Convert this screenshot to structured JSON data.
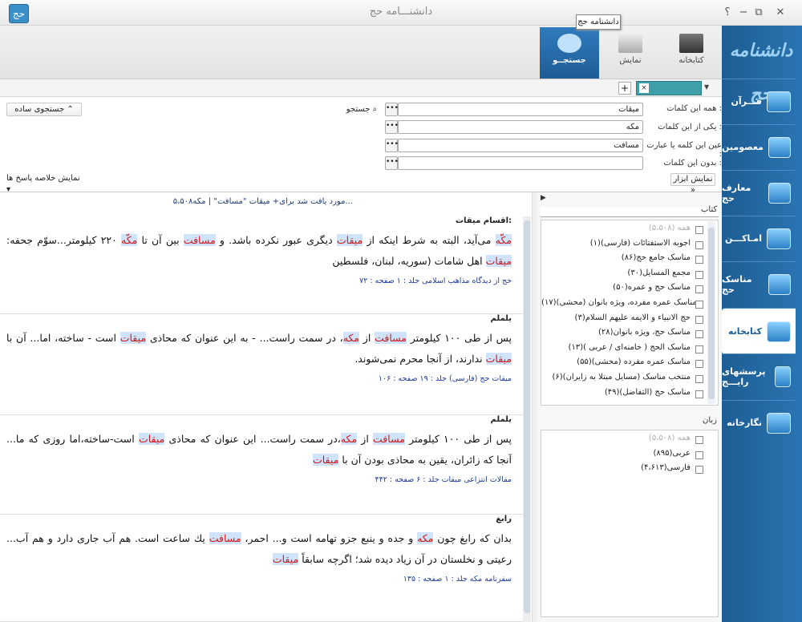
{
  "window": {
    "title": "دانشنـــامه حج",
    "help": "؟",
    "minimize": "−",
    "restore": "⧉",
    "close": "✕",
    "tooltip": "دانشنامه حج"
  },
  "sidebar": {
    "logo": "دانشنامه حج",
    "items": [
      {
        "label": "قـــرآن"
      },
      {
        "label": "معصومین"
      },
      {
        "label": "معارف حج"
      },
      {
        "label": "امـاکـــن"
      },
      {
        "label": "مناسک حج"
      },
      {
        "label": "کتابخانه"
      },
      {
        "label": "پرسشهای رایـــج"
      },
      {
        "label": "نگارخانه"
      }
    ]
  },
  "ribbon": {
    "tabs": [
      {
        "label": "کتابخانه"
      },
      {
        "label": "نمایش"
      },
      {
        "label": "جستجــو"
      }
    ]
  },
  "tabstrip": {
    "close": "×",
    "add": "+",
    "dropdown": "▼"
  },
  "form": {
    "all_words_label": "همه این کلمات :",
    "all_words_value": "میقات",
    "any_words_label": "یکی از این کلمات :",
    "any_words_value": "مکه",
    "exact_label": "عین این کلمه یا عبارت :",
    "exact_value": "مسافت",
    "without_label": "بدون این کلمات :",
    "without_value": "",
    "dots": "•••",
    "search_button": "جستجو ⌕",
    "simple_search": "جستجوی ساده  ⌃",
    "tools": "نمایش ابزار »",
    "summary": "نمایش خلاصه پاسخ ها ▾"
  },
  "results": {
    "count_text": "۵،۵۰۸مورد یافت شد برای+ میقات \"مسافت\" | مکه...",
    "items": [
      {
        "title": "اقسام میقات:",
        "parts": [
          [
            "hl",
            "مکّه"
          ],
          [
            "t",
            " می‌آید، البته به شرط اینکه از "
          ],
          [
            "hl",
            "میقات"
          ],
          [
            "t",
            " دیگری عبور نکرده باشد. و "
          ],
          [
            "hl",
            "مسافت"
          ],
          [
            "t",
            " بین آن تا "
          ],
          [
            "hl",
            "مکّه"
          ],
          [
            "t",
            " ۲۲۰ کیلومتر...سوّم جحفه: "
          ],
          [
            "hl",
            "میقات"
          ],
          [
            "t",
            " اهل شامات (سوریه، لبنان، فلسطین"
          ]
        ],
        "source": "حج از دیدگاه مذاهب اسلامی جلد : ۱ صفحه : ۷۲"
      },
      {
        "title": "یلملم",
        "parts": [
          [
            "t",
            "پس از طی ۱۰۰ کیلومتر "
          ],
          [
            "hl",
            "مسافت"
          ],
          [
            "t",
            " از "
          ],
          [
            "hl",
            "مکه"
          ],
          [
            "t",
            "، در سمت راست... - به این عنوان که محاذی "
          ],
          [
            "hl",
            "میقات"
          ],
          [
            "t",
            " است - ساخته، اما... آن با "
          ],
          [
            "hl",
            "میقات"
          ],
          [
            "t",
            " ندارند، از آنجا محرم نمی‌شوند."
          ]
        ],
        "source": "میقات حج (فارسی) جلد : ۱۹ صفحه : ۱۰۶"
      },
      {
        "title": "یلملم",
        "parts": [
          [
            "t",
            "پس از طی ۱۰۰ کیلومتر "
          ],
          [
            "hl",
            "مسافت"
          ],
          [
            "t",
            " از "
          ],
          [
            "hl",
            "مکه"
          ],
          [
            "t",
            "،در سمت راست... این عنوان که محاذی "
          ],
          [
            "hl",
            "میقات"
          ],
          [
            "t",
            " است-ساخته،اما روزی که ما... آنجا که زائران، یقین به محاذی بودن آن با "
          ],
          [
            "hl",
            "میقات"
          ]
        ],
        "source": "مقالات انتزاعی میقات جلد : ۶ صفحه : ۴۴۲"
      },
      {
        "title": "رابغ",
        "parts": [
          [
            "t",
            "بدان که رابغ چون "
          ],
          [
            "hl",
            "مکه"
          ],
          [
            "t",
            " و جده و ینبع جزو تهامه است و... احمر، "
          ],
          [
            "hl",
            "مسافت"
          ],
          [
            "t",
            " یك ساعت است. هم آب جاری دارد و هم آب... رعیتی و نخلستان در آن زیاد دیده شد؛ اگرچه سابقاً "
          ],
          [
            "hl",
            "میقات"
          ]
        ],
        "source": "سفرنامه مکه جلد : ۱ صفحه : ۱۳۵"
      }
    ]
  },
  "filters": {
    "books_label": "کتاب",
    "books": [
      {
        "label": "همه (۵،۵۰۸)",
        "all": true
      },
      {
        "label": "اجوبه الاستفتائات (فارسی)(۱)"
      },
      {
        "label": "مناسک جامع حج(۸۶)"
      },
      {
        "label": "مجمع المسایل(۳۰)"
      },
      {
        "label": "مناسک حج و عمره(۵۰)"
      },
      {
        "label": "مناسک عمره مفرده، ویژه بانوان (محشی)(۱۷)"
      },
      {
        "label": "حج الانبیاء و الایمه علیهم السلام(۳)"
      },
      {
        "label": "مناسک حج، ویژه بانوان(۲۸)"
      },
      {
        "label": "مناسک الحج ( خامنه‌ای / عربی )(۱۳)"
      },
      {
        "label": "مناسک عمره مفرده (محشی)(۵۵)"
      },
      {
        "label": "منتخب مناسک (مسایل مبتلا به زایران)(۶)"
      },
      {
        "label": "مناسک حج (التفاضل)(۴۹)"
      }
    ],
    "lang_label": "زبان",
    "langs": [
      {
        "label": "همه (۵،۵۰۸)",
        "all": true
      },
      {
        "label": "عربی(۸۹۵)"
      },
      {
        "label": "فارسی(۴،۶۱۳)"
      }
    ],
    "panel_arrow": "▶"
  }
}
